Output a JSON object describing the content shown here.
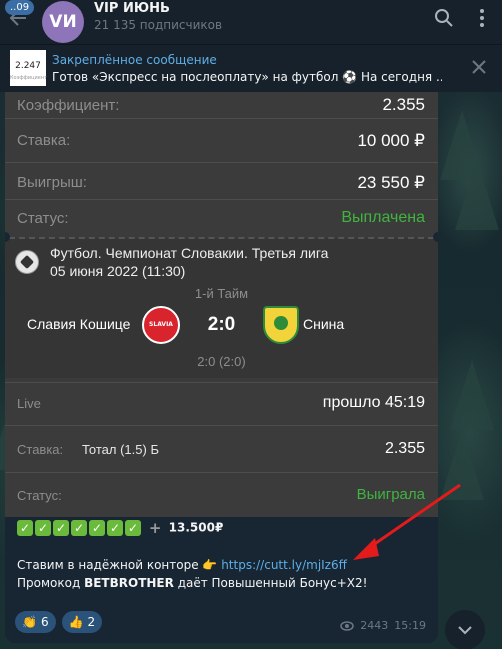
{
  "header": {
    "badge": "..09",
    "avatar_initials": "VИ",
    "title": "VIP ИЮНЬ",
    "subscribers": "21 135 подписчиков",
    "avatar_color": "#8e74b8"
  },
  "pinned": {
    "thumb_value": "2.247",
    "thumb_caption": "Коэффициент",
    "title": "Закреплённое сообщение",
    "text": "Готов «Экспресс на послеоплату» на футбол ⚽   На сегодня ..."
  },
  "bet": {
    "coef_label": "Коэффициент:",
    "coef_value": "2.355",
    "stake_label": "Ставка:",
    "stake_value": "10 000 ₽",
    "win_label": "Выигрыш:",
    "win_value": "23 550 ₽",
    "status_label": "Статус:",
    "status_value": "Выплачена"
  },
  "match": {
    "title_line1": "Футбол. Чемпионат Словакии. Третья лига",
    "title_line2": "05 июня 2022 (11:30)",
    "half": "1-й Тайм",
    "home": "Славия Кошице",
    "away": "Снина",
    "score": "2:0",
    "half_score": "2:0 (2:0)",
    "home_logo_text": "SLAVIA"
  },
  "live": {
    "live_label": "Live",
    "live_value": "прошло 45:19",
    "stake_label": "Ставка:",
    "stake_market": "Тотал (1.5) Б",
    "stake_value": "2.355",
    "status_label": "Статус:",
    "status_value": "Выиграла"
  },
  "message": {
    "profit": "13.500₽",
    "line1": "Ставим в надёжной конторе 👉",
    "link": "https://cutt.ly/mjIz6ff",
    "line2_prefix": "Промокод ",
    "promo": "BETBROTHER",
    "line2_suffix": " даёт Повышенный Бонус+Х2!"
  },
  "reactions": [
    {
      "emoji": "👏",
      "count": "6"
    },
    {
      "emoji": "👍",
      "count": "2"
    }
  ],
  "meta": {
    "views": "2443",
    "time": "15:19"
  },
  "colors": {
    "link": "#5eaee6",
    "success": "#3fb43f",
    "annotation": "#e31b1b"
  }
}
